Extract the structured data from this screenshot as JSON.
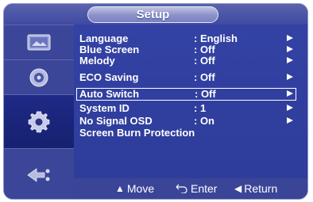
{
  "header": {
    "title": "Setup"
  },
  "sidebar": {
    "items": [
      {
        "icon": "picture-icon",
        "active": false
      },
      {
        "icon": "sound-icon",
        "active": false
      },
      {
        "icon": "gear-icon",
        "active": true
      },
      {
        "icon": "input-icon",
        "active": false
      }
    ]
  },
  "menu": {
    "items": [
      {
        "label": "Language",
        "value": ": English",
        "has_submenu": true,
        "selected": false
      },
      {
        "label": "Blue Screen",
        "value": ": Off",
        "has_submenu": true,
        "selected": false
      },
      {
        "label": "Melody",
        "value": ": Off",
        "has_submenu": true,
        "selected": false
      },
      {
        "label": "ECO Saving",
        "value": ": Off",
        "has_submenu": true,
        "selected": false
      },
      {
        "label": "Auto Switch",
        "value": ": Off",
        "has_submenu": true,
        "selected": true
      },
      {
        "label": "System ID",
        "value": ": 1",
        "has_submenu": true,
        "selected": false
      },
      {
        "label": "No Signal OSD",
        "value": ": On",
        "has_submenu": true,
        "selected": false
      },
      {
        "label": "Screen Burn Protection",
        "value": "",
        "has_submenu": false,
        "selected": false
      }
    ]
  },
  "footer": {
    "move_label": "Move",
    "enter_label": "Enter",
    "return_label": "Return"
  },
  "colors": {
    "panel": "#2d3a97",
    "title_pill": "#8a91c9",
    "active_sidebar": "#1e2a86",
    "text": "#ffffff"
  }
}
